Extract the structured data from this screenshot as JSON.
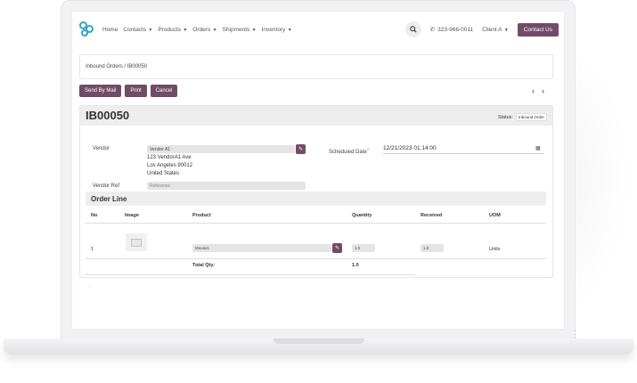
{
  "nav": {
    "menu": [
      "Home",
      "Contacts",
      "Products",
      "Orders",
      "Shipments",
      "Inventory"
    ],
    "menu_dropdowns": [
      "Contacts",
      "Products",
      "Orders",
      "Shipments",
      "Inventory"
    ],
    "phone": "323-966-0011",
    "user": "Client A",
    "contact_label": "Contact Us"
  },
  "breadcrumb": {
    "parent": "Inbound Orders",
    "separator": "/",
    "current": "IB00050"
  },
  "actions": {
    "send_label": "Send By Mail",
    "print_label": "Print",
    "cancel_label": "Cancel"
  },
  "record": {
    "title": "IB00050",
    "status_label": "Status:",
    "status_value": "Inbound Order",
    "vendor_label": "Vendor",
    "vendor_value": "Vendor A1",
    "address": [
      "123 VendorA1 Ave",
      "Los Angeles 90012",
      "United States"
    ],
    "vendor_ref_label": "Vendor Ref",
    "vendor_ref_placeholder": "Reference",
    "scheduled_label": "Scheduled Date",
    "scheduled_required_mark": "?",
    "scheduled_value": "12/21/2023 01:14:00"
  },
  "order_line": {
    "section_title": "Order Line",
    "columns": [
      "No",
      "Image",
      "Product",
      "Quantity",
      "Received",
      "UOM"
    ],
    "rows": [
      {
        "no": "1",
        "product": "Mouse1",
        "quantity": "1.0",
        "received": "1.0",
        "uom": "Units"
      }
    ],
    "total_label": "Total Qty:",
    "total_value": "1.0"
  },
  "colors": {
    "brand": "#714b67",
    "logo": "#2aa7c9"
  },
  "icons": [
    "logo-icon",
    "search-icon",
    "phone-icon",
    "edit-icon",
    "calendar-icon",
    "chevron-left-icon",
    "chevron-right-icon",
    "image-placeholder-icon"
  ]
}
